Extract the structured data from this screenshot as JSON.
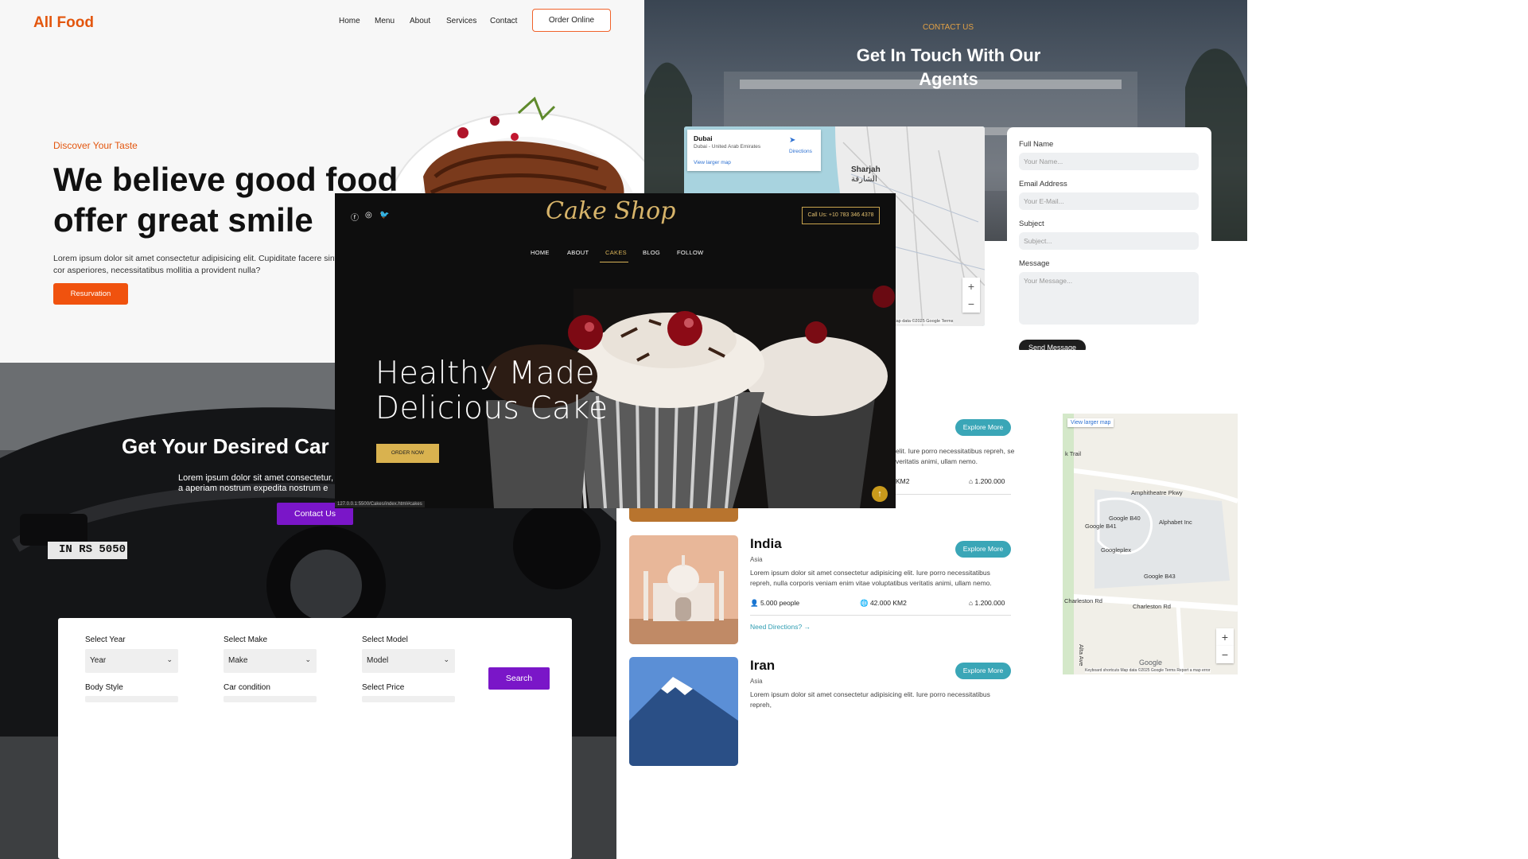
{
  "food": {
    "logo": "All Food",
    "nav": [
      "Home",
      "Menu",
      "About",
      "Services",
      "Contact"
    ],
    "order_btn": "Order Online",
    "kicker": "Discover Your Taste",
    "hero": "We believe good food offer great smile",
    "lead": "Lorem ipsum dolor sit amet consectetur adipisicing elit. Cupiditate facere sint ut cor asperiores, necessitatibus mollitia a provident nulla?",
    "reservation_btn": "Resurvation",
    "accent": "#e3560e"
  },
  "agents": {
    "kicker": "CONTACT US",
    "title": "Get In Touch With Our Agents",
    "map": {
      "place": "Dubai",
      "address": "Dubai - United Arab Emirates",
      "directions": "Directions",
      "larger": "View larger map",
      "city": "Sharjah",
      "city_ar": "الشارقة",
      "footer": "Map data ©2025 Google   Terms"
    },
    "labels": {
      "name": "Full Name",
      "email": "Email Address",
      "subject": "Subject",
      "message": "Message"
    },
    "placeholders": {
      "name": "Your Name...",
      "email": "Your E-Mail...",
      "subject": "Subject...",
      "message": "Your Message..."
    },
    "send_btn": "Send Message"
  },
  "car": {
    "title": "Get Your Desired Car I",
    "lead": "Lorem ipsum dolor sit amet consectetur, a aperiam nostrum expedita nostrum e",
    "contact_btn": "Contact Us",
    "plate": "IN RS 5050",
    "labels": {
      "year": "Select Year",
      "make": "Select Make",
      "model": "Select Model",
      "body": "Body Style",
      "condition": "Car condition",
      "price": "Select Price"
    },
    "values": {
      "year": "Year",
      "make": "Make",
      "model": "Model"
    },
    "search_btn": "Search",
    "accent": "#7a16c8"
  },
  "countries": {
    "partial": {
      "desc": "elit. Iure porro necessitatibus repreh, se veritatis animi, ullam nemo.",
      "area": "KM2",
      "price": "1.200.000",
      "explore": "Explore More"
    },
    "items": [
      {
        "name": "India",
        "region": "Asia",
        "desc": "Lorem ipsum dolor sit amet consectetur adipisicing elit. Iure porro necessitatibus repreh, nulla corporis veniam enim vitae voluptatibus veritatis animi, ullam nemo.",
        "people": "5.000 people",
        "area": "42.000 KM2",
        "price": "1.200.000",
        "explore": "Explore More",
        "directions": "Need Directions?"
      },
      {
        "name": "Iran",
        "region": "Asia",
        "desc": "Lorem ipsum dolor sit amet consectetur adipisicing elit. Iure porro necessitatibus repreh,",
        "explore": "Explore More"
      }
    ],
    "accent": "#3aa6b7"
  },
  "gmap": {
    "larger": "View larger map",
    "labels": [
      "Amphitheatre Pkwy",
      "Google B40",
      "Alphabet Inc",
      "Google B41",
      "Googleplex",
      "Google B43",
      "Charleston Rd",
      "Charleston Rd",
      "Alta Ave",
      "k Trail"
    ],
    "footer": "Keyboard shortcuts   Map data ©2025 Google   Terms   Report a map error",
    "brand": "Google"
  },
  "cake": {
    "logo": "Cake Shop",
    "call": "Call Us: +10 783 346 4378",
    "nav": [
      "HOME",
      "ABOUT",
      "CAKES",
      "BLOG",
      "FOLLOW"
    ],
    "active": "CAKES",
    "hero_line1": "Healthy Made",
    "hero_line2": "Delicious Cake",
    "order_btn": "ORDER NOW",
    "url": "127.0.0.1:5500/Cakes/index.html#cakes",
    "accent": "#d8b257"
  }
}
